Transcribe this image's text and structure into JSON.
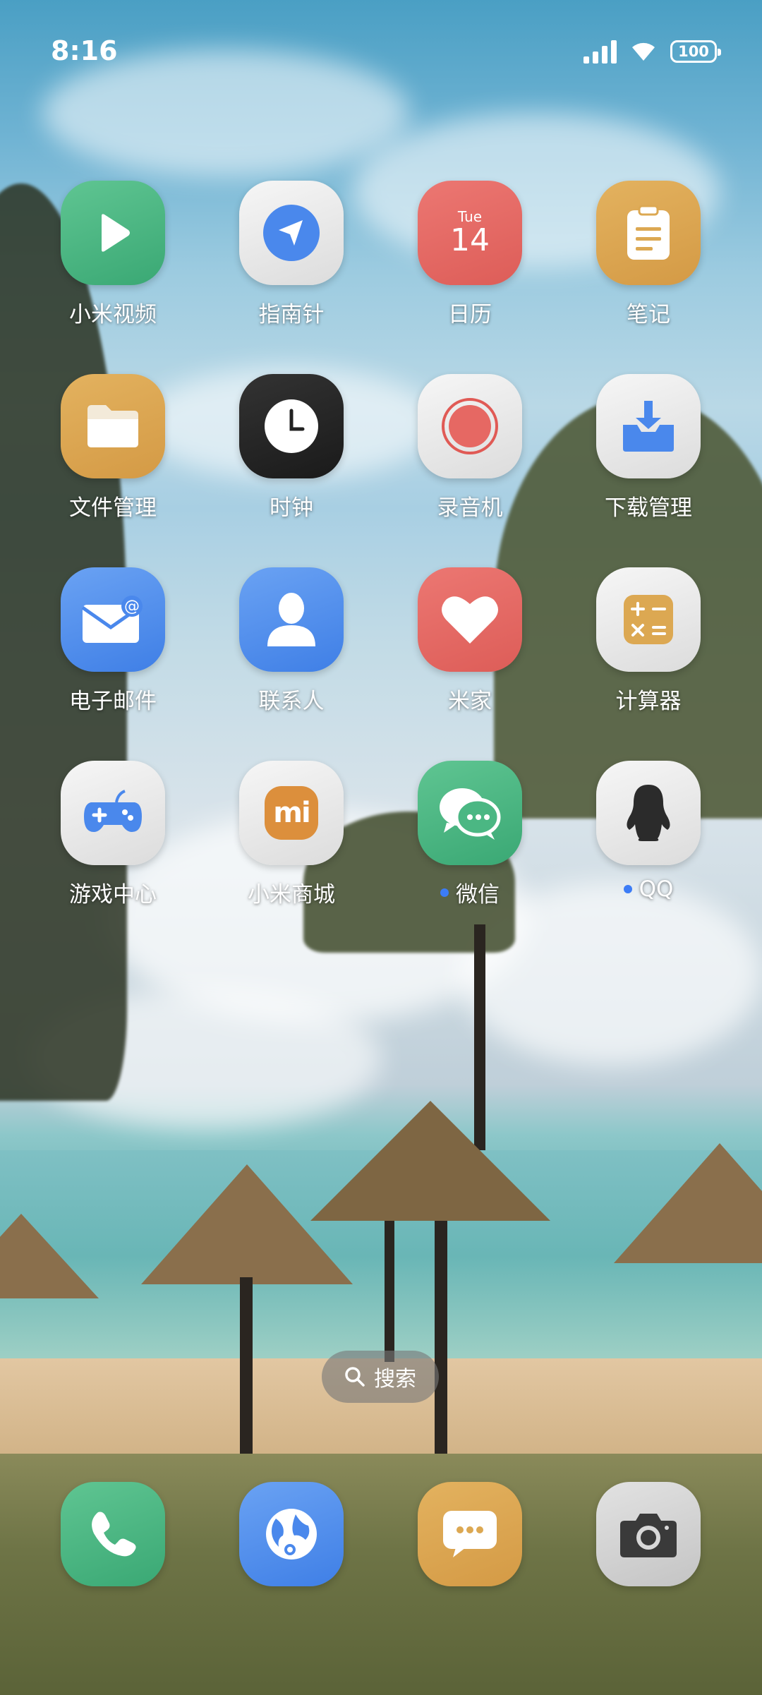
{
  "status_bar": {
    "time": "8:16",
    "battery": "100"
  },
  "apps": [
    {
      "label": "小米视频",
      "icon": "play-icon",
      "dot": false
    },
    {
      "label": "指南针",
      "icon": "compass-icon",
      "dot": false
    },
    {
      "label": "日历",
      "icon": "calendar-icon",
      "dot": false,
      "day": "Tue",
      "date": "14"
    },
    {
      "label": "笔记",
      "icon": "notes-icon",
      "dot": false
    },
    {
      "label": "文件管理",
      "icon": "folder-icon",
      "dot": false
    },
    {
      "label": "时钟",
      "icon": "clock-icon",
      "dot": false
    },
    {
      "label": "录音机",
      "icon": "record-icon",
      "dot": false
    },
    {
      "label": "下载管理",
      "icon": "download-icon",
      "dot": false
    },
    {
      "label": "电子邮件",
      "icon": "email-icon",
      "dot": false
    },
    {
      "label": "联系人",
      "icon": "contacts-icon",
      "dot": false
    },
    {
      "label": "米家",
      "icon": "heart-icon",
      "dot": false
    },
    {
      "label": "计算器",
      "icon": "calculator-icon",
      "dot": false
    },
    {
      "label": "游戏中心",
      "icon": "gamepad-icon",
      "dot": false
    },
    {
      "label": "小米商城",
      "icon": "mi-store-icon",
      "dot": false,
      "logo_text": "mi"
    },
    {
      "label": "微信",
      "icon": "wechat-icon",
      "dot": true
    },
    {
      "label": "QQ",
      "icon": "penguin-icon",
      "dot": true
    }
  ],
  "search": {
    "label": "搜索"
  },
  "dock": [
    {
      "icon": "phone-icon"
    },
    {
      "icon": "browser-icon"
    },
    {
      "icon": "messages-icon"
    },
    {
      "icon": "camera-icon"
    }
  ],
  "colors": {
    "green": "#4bb783",
    "red": "#e26a65",
    "orange": "#dca852",
    "blue": "#4a88ec",
    "notification_dot": "#3c7cf6"
  }
}
